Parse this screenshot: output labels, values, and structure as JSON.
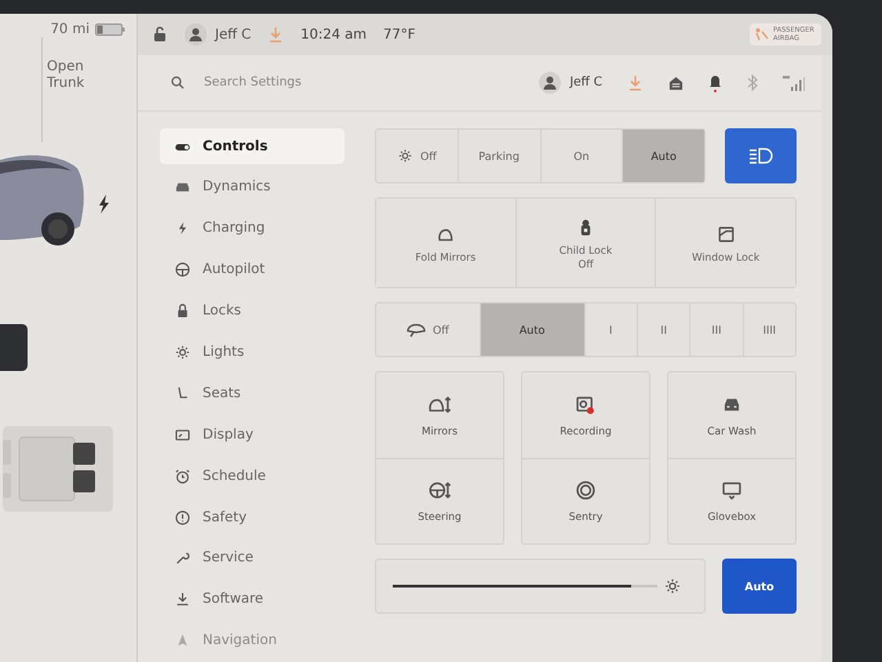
{
  "status_bar": {
    "range": "70 mi",
    "driver": "Jeff C",
    "time": "10:24 am",
    "temperature": "77°F",
    "airbag_label": "PASSENGER AIRBAG"
  },
  "car_panel": {
    "trunk_label": "Open Trunk"
  },
  "settings_header": {
    "search": {
      "placeholder": "Search Settings"
    },
    "profile": "Jeff C"
  },
  "sidebar": {
    "items": [
      {
        "label": "Controls",
        "selected": true,
        "dimmed": false
      },
      {
        "label": "Dynamics",
        "selected": false,
        "dimmed": false
      },
      {
        "label": "Charging",
        "selected": false,
        "dimmed": false
      },
      {
        "label": "Autopilot",
        "selected": false,
        "dimmed": false
      },
      {
        "label": "Locks",
        "selected": false,
        "dimmed": false
      },
      {
        "label": "Lights",
        "selected": false,
        "dimmed": false
      },
      {
        "label": "Seats",
        "selected": false,
        "dimmed": false
      },
      {
        "label": "Display",
        "selected": false,
        "dimmed": false
      },
      {
        "label": "Schedule",
        "selected": false,
        "dimmed": false
      },
      {
        "label": "Safety",
        "selected": false,
        "dimmed": false
      },
      {
        "label": "Service",
        "selected": false,
        "dimmed": false
      },
      {
        "label": "Software",
        "selected": false,
        "dimmed": false
      },
      {
        "label": "Navigation",
        "selected": false,
        "dimmed": true
      }
    ]
  },
  "headlights": {
    "options": [
      {
        "label": "Off",
        "selected": false
      },
      {
        "label": "Parking",
        "selected": false
      },
      {
        "label": "On",
        "selected": false
      },
      {
        "label": "Auto",
        "selected": true
      }
    ],
    "auto_high_beam": {
      "on": true
    }
  },
  "toggles": [
    {
      "label": "Fold Mirrors"
    },
    {
      "label": "Child Lock",
      "value": "Off"
    },
    {
      "label": "Window Lock"
    }
  ],
  "wipers": {
    "options": [
      {
        "label": "Off",
        "selected": false
      },
      {
        "label": "Auto",
        "selected": true
      },
      {
        "label": "I",
        "selected": false
      },
      {
        "label": "II",
        "selected": false
      },
      {
        "label": "III",
        "selected": false
      },
      {
        "label": "IIII",
        "selected": false
      }
    ]
  },
  "tiles": [
    {
      "label": "Mirrors"
    },
    {
      "label": "Recording"
    },
    {
      "label": "Car Wash"
    },
    {
      "label": "Steering"
    },
    {
      "label": "Sentry"
    },
    {
      "label": "Glovebox"
    }
  ],
  "brightness": {
    "level": 0.9,
    "auto": {
      "label": "Auto",
      "on": true
    }
  }
}
